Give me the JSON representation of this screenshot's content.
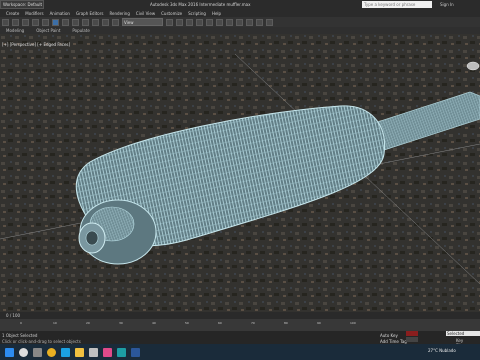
{
  "titlebar": {
    "workspace": "Workspace: Default",
    "app_title": "Autodesk 3ds Max 2016    Intermediate muffler.max",
    "search_placeholder": "Type a keyword or phrase",
    "signin": "Sign In"
  },
  "menu": [
    "Create",
    "Modifiers",
    "Animation",
    "Graph Editors",
    "Rendering",
    "Civil View",
    "Customize",
    "Scripting",
    "Help"
  ],
  "toolbar": {
    "view_dropdown": "View"
  },
  "ribbon": [
    "Modeling",
    "Object Paint",
    "Populate"
  ],
  "viewport": {
    "label": "[+] [Perspective] [+ Edged Faces]"
  },
  "status": {
    "selection": "1 Object Selected",
    "prompt": "Click or click-and-drag to select objects"
  },
  "timeline": {
    "frame": "0 / 100",
    "ticks": [
      "0",
      "10",
      "20",
      "30",
      "40",
      "50",
      "60",
      "70",
      "80",
      "90",
      "100"
    ]
  },
  "bottom": {
    "add_key": "Auto Key",
    "add_time_tag": "Add Time Tag",
    "set_key": "Set Key",
    "selected": "Selected",
    "key_filters": "Key Filters..."
  },
  "taskbar": {
    "weather": "27°C  Nublado",
    "icons": [
      "windows-icon",
      "search-icon",
      "task-view-icon",
      "chrome-icon",
      "edge-icon",
      "explorer-icon",
      "store-icon",
      "photos-icon",
      "3dsmax-icon",
      "word-icon"
    ]
  },
  "colors": {
    "wireframe": "#9ecbd6",
    "autokey": "#8a1e1e"
  }
}
